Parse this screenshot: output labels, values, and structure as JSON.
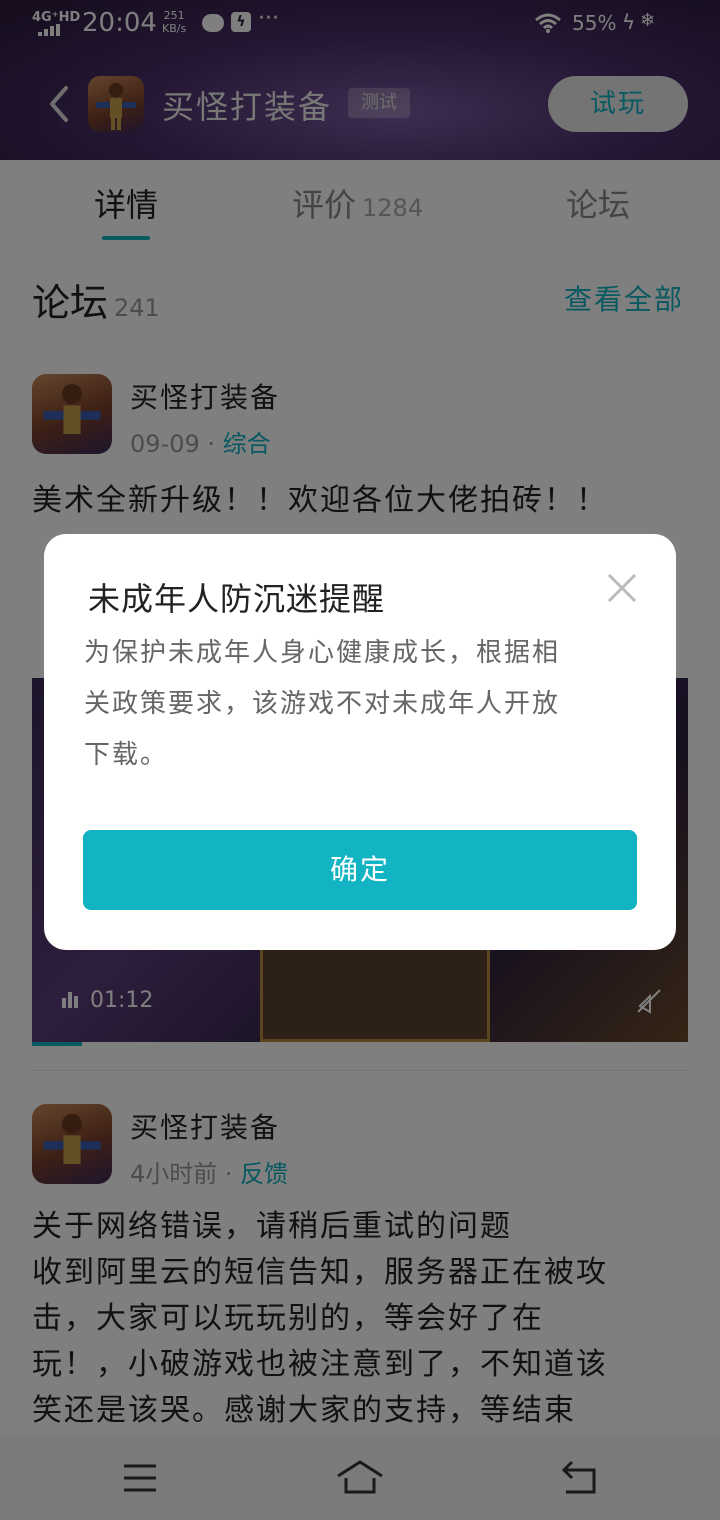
{
  "status_bar": {
    "network": "4G⁺HD",
    "time": "20:04",
    "speed_value": "251",
    "speed_unit": "KB/s",
    "more": "···",
    "battery": "55%"
  },
  "header": {
    "app_title": "买怪打装备",
    "badge": "测试",
    "try_button": "试玩"
  },
  "tabs": [
    {
      "label": "详情",
      "count": ""
    },
    {
      "label": "评价",
      "count": "1284"
    },
    {
      "label": "论坛",
      "count": ""
    }
  ],
  "forum": {
    "title": "论坛",
    "count": "241",
    "see_all": "查看全部"
  },
  "posts": [
    {
      "author": "买怪打装备",
      "date": "09-09",
      "sep": " · ",
      "category": "综合",
      "body": "美术全新升级！！欢迎各位大佬拍砖！！",
      "video_duration": "01:12"
    },
    {
      "author": "买怪打装备",
      "date": "4小时前",
      "sep": " · ",
      "category": "反馈",
      "body_lines": [
        "关于网络错误，请稍后重试的问题",
        "收到阿里云的短信告知，服务器正在被攻",
        "击，大家可以玩玩别的，等会好了在",
        "玩！，小破游戏也被注意到了，不知道该",
        "笑还是该哭。感谢大家的支持，等结束"
      ]
    }
  ],
  "dialog": {
    "title": "未成年人防沉迷提醒",
    "body_lines": [
      "为保护未成年人身心健康成长，根据相",
      "关政策要求，该游戏不对未成年人开放",
      "下载。"
    ],
    "confirm": "确定"
  },
  "colors": {
    "accent": "#12b3c2",
    "header_bg": "#4a2f6a",
    "overlay": "rgba(0,0,0,0.5)"
  }
}
